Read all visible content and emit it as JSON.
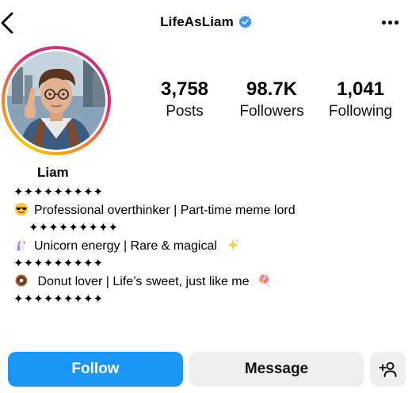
{
  "header": {
    "username": "LifeAsLiam",
    "verified": true,
    "back_icon": "chevron-left-icon",
    "more_icon": "more-horizontal-icon"
  },
  "profile": {
    "display_name": "Liam",
    "avatar_icon": "profile-avatar",
    "ring_colors": [
      "#f9c900",
      "#f58529",
      "#dd2a7b",
      "#c13584"
    ]
  },
  "stats": [
    {
      "value": "3,758",
      "label": "Posts"
    },
    {
      "value": "98.7K",
      "label": "Followers"
    },
    {
      "value": "1,041",
      "label": "Following"
    }
  ],
  "bio": {
    "divider": "✦✦✦✦✦✦✦✦✦",
    "lines": [
      {
        "emoji": "smiling-face-with-sunglasses",
        "text": "Professional overthinker | Part-time meme lord"
      },
      {
        "emoji": "unicorn",
        "text": "Unicorn energy | Rare & magical",
        "trail_emoji": "sparkles"
      },
      {
        "emoji": "donut",
        "text": " Donut lover | Life’s sweet, just like me",
        "trail_emoji": "lollipop"
      }
    ]
  },
  "actions": {
    "follow_label": "Follow",
    "message_label": "Message",
    "add_user_icon": "add-person-icon",
    "follow_color": "#1a96f5",
    "secondary_color": "#efefef"
  }
}
